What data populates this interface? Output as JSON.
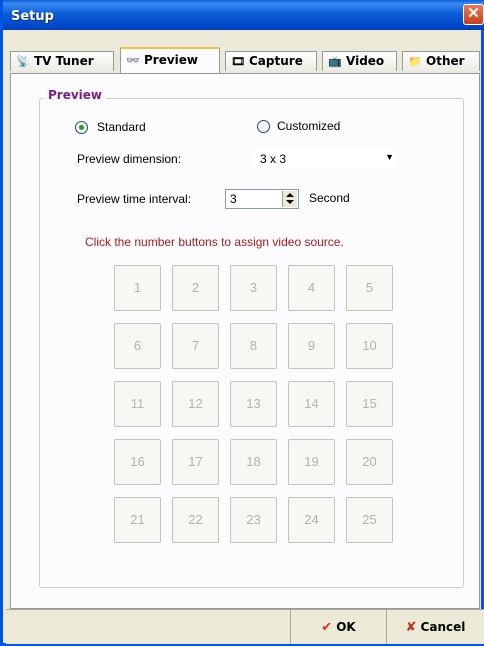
{
  "window": {
    "title": "Setup",
    "close_glyph": "✕"
  },
  "tabs": [
    {
      "label": "TV Tuner",
      "icon": "tv-tuner-icon",
      "glyph": "📡",
      "active": false
    },
    {
      "label": "Preview",
      "icon": "glasses-icon",
      "glyph": "👓",
      "active": true
    },
    {
      "label": "Capture",
      "icon": "capture-icon",
      "glyph": "🎞",
      "active": false
    },
    {
      "label": "Video",
      "icon": "video-icon",
      "glyph": "📺",
      "active": false
    },
    {
      "label": "Other",
      "icon": "other-icon",
      "glyph": "📁",
      "active": false
    }
  ],
  "preview": {
    "group_label": "Preview",
    "mode": {
      "standard_label": "Standard",
      "customized_label": "Customized",
      "selected": "Standard"
    },
    "dimension": {
      "label": "Preview dimension:",
      "value": "3 x 3",
      "arrow": "▼"
    },
    "interval": {
      "label": "Preview time interval:",
      "value": "3",
      "unit": "Second"
    },
    "hint": "Click the number buttons to assign video source.",
    "buttons": [
      "1",
      "2",
      "3",
      "4",
      "5",
      "6",
      "7",
      "8",
      "9",
      "10",
      "11",
      "12",
      "13",
      "14",
      "15",
      "16",
      "17",
      "18",
      "19",
      "20",
      "21",
      "22",
      "23",
      "24",
      "25"
    ]
  },
  "footer": {
    "ok_label": "OK",
    "ok_icon": "check-icon",
    "ok_glyph": "✔",
    "cancel_label": "Cancel",
    "cancel_icon": "x-icon",
    "cancel_glyph": "✘"
  },
  "colors": {
    "title_bar": "#0054e3",
    "group_label": "#7a1e88",
    "hint": "#a01e1e",
    "ok_check": "#e0301e",
    "cancel_x": "#c03010"
  }
}
